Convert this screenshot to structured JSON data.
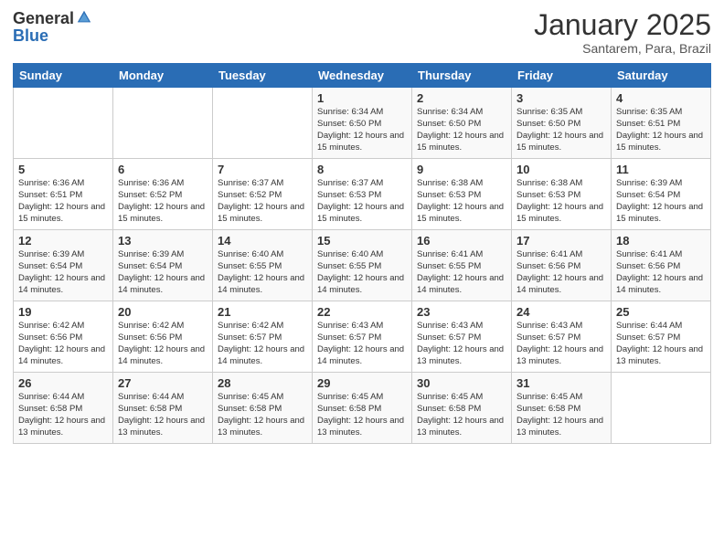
{
  "header": {
    "logo_general": "General",
    "logo_blue": "Blue",
    "month_title": "January 2025",
    "subtitle": "Santarem, Para, Brazil"
  },
  "days_of_week": [
    "Sunday",
    "Monday",
    "Tuesday",
    "Wednesday",
    "Thursday",
    "Friday",
    "Saturday"
  ],
  "weeks": [
    [
      {
        "day": "",
        "info": ""
      },
      {
        "day": "",
        "info": ""
      },
      {
        "day": "",
        "info": ""
      },
      {
        "day": "1",
        "info": "Sunrise: 6:34 AM\nSunset: 6:50 PM\nDaylight: 12 hours and 15 minutes."
      },
      {
        "day": "2",
        "info": "Sunrise: 6:34 AM\nSunset: 6:50 PM\nDaylight: 12 hours and 15 minutes."
      },
      {
        "day": "3",
        "info": "Sunrise: 6:35 AM\nSunset: 6:50 PM\nDaylight: 12 hours and 15 minutes."
      },
      {
        "day": "4",
        "info": "Sunrise: 6:35 AM\nSunset: 6:51 PM\nDaylight: 12 hours and 15 minutes."
      }
    ],
    [
      {
        "day": "5",
        "info": "Sunrise: 6:36 AM\nSunset: 6:51 PM\nDaylight: 12 hours and 15 minutes."
      },
      {
        "day": "6",
        "info": "Sunrise: 6:36 AM\nSunset: 6:52 PM\nDaylight: 12 hours and 15 minutes."
      },
      {
        "day": "7",
        "info": "Sunrise: 6:37 AM\nSunset: 6:52 PM\nDaylight: 12 hours and 15 minutes."
      },
      {
        "day": "8",
        "info": "Sunrise: 6:37 AM\nSunset: 6:53 PM\nDaylight: 12 hours and 15 minutes."
      },
      {
        "day": "9",
        "info": "Sunrise: 6:38 AM\nSunset: 6:53 PM\nDaylight: 12 hours and 15 minutes."
      },
      {
        "day": "10",
        "info": "Sunrise: 6:38 AM\nSunset: 6:53 PM\nDaylight: 12 hours and 15 minutes."
      },
      {
        "day": "11",
        "info": "Sunrise: 6:39 AM\nSunset: 6:54 PM\nDaylight: 12 hours and 15 minutes."
      }
    ],
    [
      {
        "day": "12",
        "info": "Sunrise: 6:39 AM\nSunset: 6:54 PM\nDaylight: 12 hours and 14 minutes."
      },
      {
        "day": "13",
        "info": "Sunrise: 6:39 AM\nSunset: 6:54 PM\nDaylight: 12 hours and 14 minutes."
      },
      {
        "day": "14",
        "info": "Sunrise: 6:40 AM\nSunset: 6:55 PM\nDaylight: 12 hours and 14 minutes."
      },
      {
        "day": "15",
        "info": "Sunrise: 6:40 AM\nSunset: 6:55 PM\nDaylight: 12 hours and 14 minutes."
      },
      {
        "day": "16",
        "info": "Sunrise: 6:41 AM\nSunset: 6:55 PM\nDaylight: 12 hours and 14 minutes."
      },
      {
        "day": "17",
        "info": "Sunrise: 6:41 AM\nSunset: 6:56 PM\nDaylight: 12 hours and 14 minutes."
      },
      {
        "day": "18",
        "info": "Sunrise: 6:41 AM\nSunset: 6:56 PM\nDaylight: 12 hours and 14 minutes."
      }
    ],
    [
      {
        "day": "19",
        "info": "Sunrise: 6:42 AM\nSunset: 6:56 PM\nDaylight: 12 hours and 14 minutes."
      },
      {
        "day": "20",
        "info": "Sunrise: 6:42 AM\nSunset: 6:56 PM\nDaylight: 12 hours and 14 minutes."
      },
      {
        "day": "21",
        "info": "Sunrise: 6:42 AM\nSunset: 6:57 PM\nDaylight: 12 hours and 14 minutes."
      },
      {
        "day": "22",
        "info": "Sunrise: 6:43 AM\nSunset: 6:57 PM\nDaylight: 12 hours and 14 minutes."
      },
      {
        "day": "23",
        "info": "Sunrise: 6:43 AM\nSunset: 6:57 PM\nDaylight: 12 hours and 13 minutes."
      },
      {
        "day": "24",
        "info": "Sunrise: 6:43 AM\nSunset: 6:57 PM\nDaylight: 12 hours and 13 minutes."
      },
      {
        "day": "25",
        "info": "Sunrise: 6:44 AM\nSunset: 6:57 PM\nDaylight: 12 hours and 13 minutes."
      }
    ],
    [
      {
        "day": "26",
        "info": "Sunrise: 6:44 AM\nSunset: 6:58 PM\nDaylight: 12 hours and 13 minutes."
      },
      {
        "day": "27",
        "info": "Sunrise: 6:44 AM\nSunset: 6:58 PM\nDaylight: 12 hours and 13 minutes."
      },
      {
        "day": "28",
        "info": "Sunrise: 6:45 AM\nSunset: 6:58 PM\nDaylight: 12 hours and 13 minutes."
      },
      {
        "day": "29",
        "info": "Sunrise: 6:45 AM\nSunset: 6:58 PM\nDaylight: 12 hours and 13 minutes."
      },
      {
        "day": "30",
        "info": "Sunrise: 6:45 AM\nSunset: 6:58 PM\nDaylight: 12 hours and 13 minutes."
      },
      {
        "day": "31",
        "info": "Sunrise: 6:45 AM\nSunset: 6:58 PM\nDaylight: 12 hours and 13 minutes."
      },
      {
        "day": "",
        "info": ""
      }
    ]
  ]
}
